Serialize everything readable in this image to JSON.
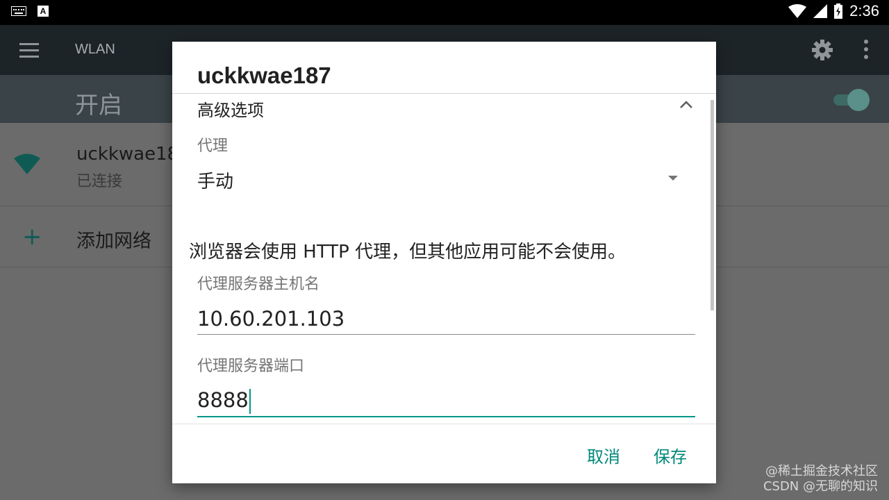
{
  "status_bar": {
    "time": "2:36",
    "a_label": "A"
  },
  "app_bar": {
    "title": "WLAN"
  },
  "switch_bar": {
    "label": "开启",
    "enabled": true
  },
  "network_list": {
    "items": [
      {
        "name": "uckkwae187",
        "status": "已连接"
      }
    ],
    "add_network_label": "添加网络"
  },
  "dialog": {
    "title": "uckkwae187",
    "advanced_options_label": "高级选项",
    "proxy_label": "代理",
    "proxy_value": "手动",
    "proxy_warning": "浏览器会使用 HTTP 代理，但其他应用可能不会使用。",
    "host_label": "代理服务器主机名",
    "host_value": "10.60.201.103",
    "port_label": "代理服务器端口",
    "port_value": "8888",
    "cancel_label": "取消",
    "save_label": "保存"
  },
  "watermark": {
    "line1": "@稀土掘金技术社区",
    "line2": "CSDN @无聊的知识"
  },
  "colors": {
    "accent": "#009688",
    "button_text": "#00897b"
  }
}
